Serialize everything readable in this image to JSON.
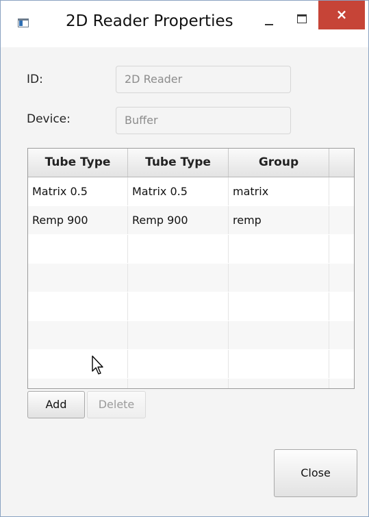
{
  "window": {
    "title": "2D Reader Properties",
    "close_glyph": "×"
  },
  "form": {
    "id_label": "ID:",
    "id_value": "2D Reader",
    "device_label": "Device:",
    "device_value": "Buffer"
  },
  "table": {
    "headers": [
      "Tube Type",
      "Tube Type",
      "Group"
    ],
    "rows": [
      [
        "Matrix 0.5",
        "Matrix 0.5",
        "matrix"
      ],
      [
        "Remp 900",
        "Remp 900",
        "remp"
      ]
    ]
  },
  "buttons": {
    "add": "Add",
    "delete": "Delete",
    "close": "Close"
  },
  "colors": {
    "close_button": "#c64437"
  }
}
